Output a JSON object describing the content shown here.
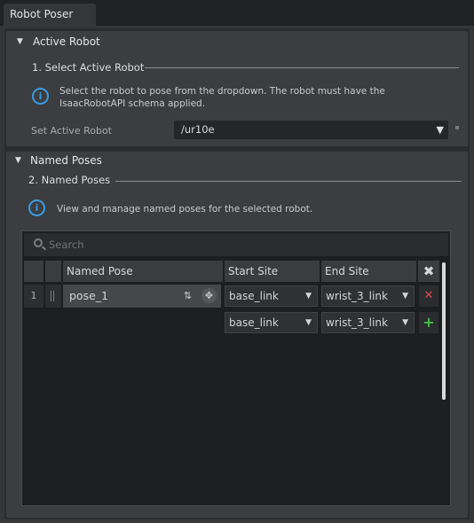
{
  "window": {
    "tab_title": "Robot Poser"
  },
  "active_robot": {
    "header": "Active Robot",
    "step_title": "1. Select Active Robot",
    "info_line1": "Select the robot to pose from the dropdown. The robot must have the",
    "info_line2": "IsaacRobotAPI schema applied.",
    "field_label": "Set Active Robot",
    "selected_robot": "/ur10e"
  },
  "named_poses": {
    "header": "Named Poses",
    "step_title": "2. Named Poses",
    "info": "View and manage named poses for the selected robot.",
    "search_placeholder": "Search",
    "columns": {
      "named_pose": "Named Pose",
      "start_site": "Start Site",
      "end_site": "End Site"
    },
    "rows": [
      {
        "index": "1",
        "name": "pose_1",
        "start_site": "base_link",
        "end_site": "wrist_3_link"
      }
    ],
    "new_row": {
      "start_site": "base_link",
      "end_site": "wrist_3_link"
    }
  },
  "icons": {
    "collapse": "triangle-down-icon",
    "info": "info-icon",
    "search": "search-icon",
    "clear_all": "close-icon",
    "delete": "delete-icon",
    "add": "add-icon",
    "edit_pose": "edit-pose-icon",
    "move_gizmo": "move-icon"
  },
  "colors": {
    "accent": "#3b9be0",
    "delete": "#e04848",
    "add": "#46c046"
  }
}
